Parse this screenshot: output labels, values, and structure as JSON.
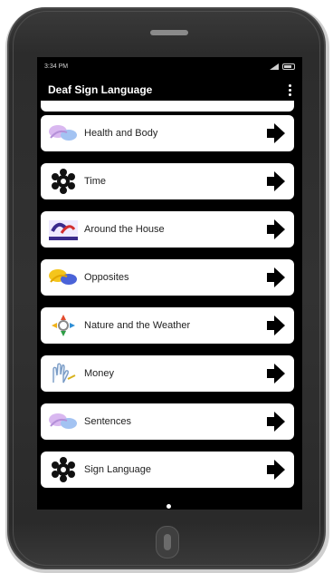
{
  "status_bar": {
    "time": "3:34 PM"
  },
  "app_bar": {
    "title": "Deaf Sign Language",
    "menu_icon": "more-vert-icon"
  },
  "items": [
    {
      "label": "Health and Body",
      "icon": "hands-sign-icon",
      "accent": "#c9a6e8"
    },
    {
      "label": "Time",
      "icon": "gear-icon",
      "accent": "#111111"
    },
    {
      "label": "Around the House",
      "icon": "house-sign-icon",
      "accent": "#3a2b8c"
    },
    {
      "label": "Opposites",
      "icon": "hands-sign-icon",
      "accent": "#f2c21a"
    },
    {
      "label": "Nature and the Weather",
      "icon": "weather-sign-icon",
      "accent": "#2f8fd6"
    },
    {
      "label": "Money",
      "icon": "hand-sketch-icon",
      "accent": "#7a9cc6"
    },
    {
      "label": "Sentences",
      "icon": "hands-sign-icon",
      "accent": "#c9a6e8"
    },
    {
      "label": "Sign Language",
      "icon": "gear-icon",
      "accent": "#111111"
    }
  ]
}
